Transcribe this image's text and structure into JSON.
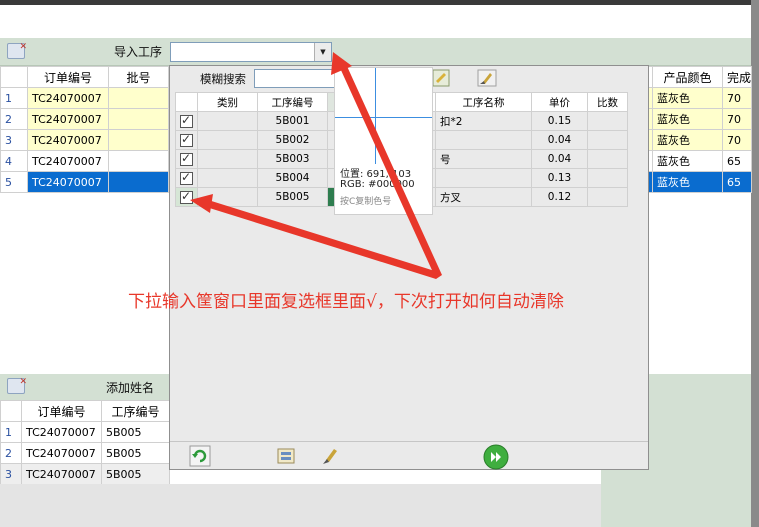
{
  "toolbar": {
    "import_label": "导入工序",
    "dropdown_value": ""
  },
  "main_table": {
    "headers": [
      "订单编号",
      "批号",
      "产品颜色",
      "完成"
    ],
    "rows": [
      {
        "num": "1",
        "order": "TC24070007",
        "color": "蓝灰色",
        "done": "70"
      },
      {
        "num": "2",
        "order": "TC24070007",
        "color": "蓝灰色",
        "done": "70"
      },
      {
        "num": "3",
        "order": "TC24070007",
        "color": "蓝灰色",
        "done": "70"
      },
      {
        "num": "4",
        "order": "TC24070007",
        "color": "蓝灰色",
        "done": "65"
      },
      {
        "num": "5",
        "order": "TC24070007",
        "color": "蓝灰色",
        "done": "65"
      }
    ]
  },
  "popup": {
    "search_label": "模糊搜索",
    "search_value": "",
    "headers": [
      "类别",
      "工序编号",
      "工序名称",
      "单价",
      "比数"
    ],
    "rows": [
      {
        "checked": true,
        "code": "5B001",
        "name": "扣*2",
        "price": "0.15"
      },
      {
        "checked": true,
        "code": "5B002",
        "name": "",
        "price": "0.04"
      },
      {
        "checked": true,
        "code": "5B003",
        "name": "号",
        "price": "0.04"
      },
      {
        "checked": true,
        "code": "5B004",
        "name": "",
        "price": "0.13"
      },
      {
        "checked": true,
        "code": "5B005",
        "name": "方叉",
        "price": "0.12"
      }
    ]
  },
  "color_picker": {
    "position": "位置: 691, 103",
    "rgb": "RGB: #000000",
    "hint": "按C复制色号"
  },
  "bottom": {
    "add_name_label": "添加姓名",
    "headers": [
      "订单编号",
      "工序编号"
    ],
    "rows": [
      {
        "num": "1",
        "order": "TC24070007",
        "code": "5B005"
      },
      {
        "num": "2",
        "order": "TC24070007",
        "code": "5B005"
      },
      {
        "num": "3",
        "order": "TC24070007",
        "code": "5B005"
      }
    ]
  },
  "annotation": {
    "text": "下拉输入筐窗口里面复选框里面√，下次打开如何自动清除",
    "color": "#e8372a"
  },
  "colors": {
    "toolbar_bg": "#d3e0d3",
    "row_highlight": "#ffffcc",
    "row_selected": "#0a6ccf"
  }
}
